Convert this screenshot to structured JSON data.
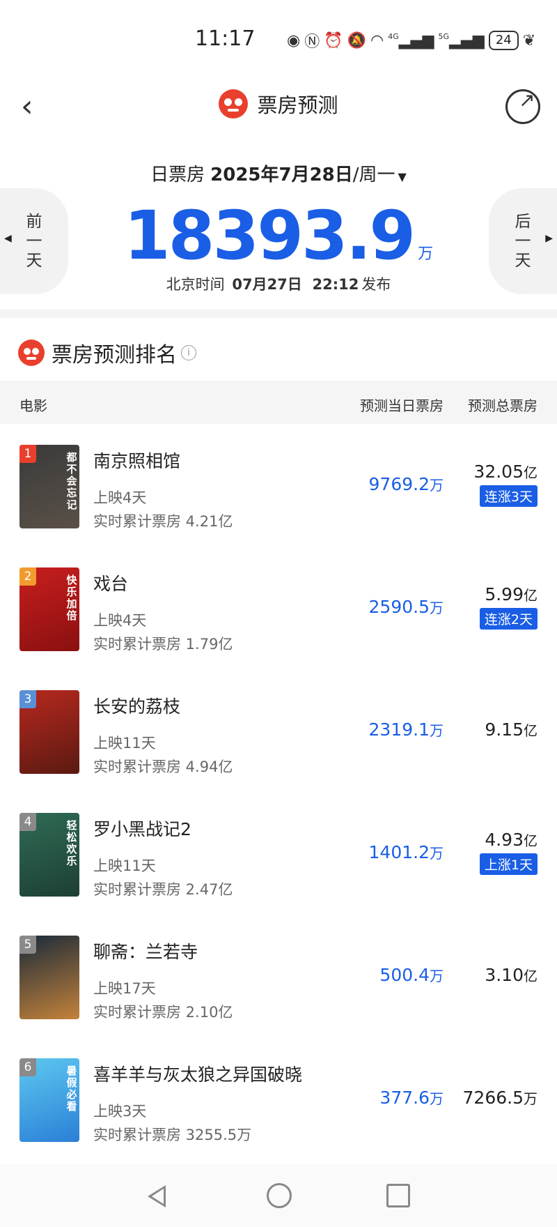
{
  "status_bar": {
    "time": "11:17",
    "battery": "24",
    "network_4g": "4G",
    "network_5g": "5G",
    "icons": [
      "eye-icon",
      "nfc-icon",
      "alarm-icon",
      "mute-icon",
      "wifi-icon",
      "signal-4g-icon",
      "signal-5g-icon",
      "battery-icon",
      "leaf-icon"
    ]
  },
  "header": {
    "title": "票房预测",
    "back_icon": "back-arrow-icon",
    "share_icon": "share-icon"
  },
  "date_selector": {
    "label": "日票房",
    "date": "2025年7月28日",
    "weekday": "/周一"
  },
  "nav_buttons": {
    "prev": [
      "前",
      "一",
      "天"
    ],
    "next": [
      "后",
      "一",
      "天"
    ]
  },
  "forecast": {
    "value": "18393.9",
    "unit": "万",
    "publish_label": "北京时间",
    "publish_date": "07月27日",
    "publish_time": "22:12",
    "publish_suffix": "发布"
  },
  "ranking": {
    "title": "票房预测排名",
    "columns": {
      "movie": "电影",
      "day_forecast": "预测当日票房",
      "total_forecast": "预测总票房"
    },
    "movies": [
      {
        "rank": "1",
        "name": "南京照相馆",
        "days": "上映4天",
        "cumulative": "实时累计票房 4.21亿",
        "day_value": "9769.2",
        "day_unit": "万",
        "total_value": "32.05",
        "total_unit": "亿",
        "trend": "连涨3天",
        "badge_color": "#e8402d",
        "poster_colors": [
          "#3a3a3a",
          "#5a5148"
        ],
        "poster_text": "都不会忘记"
      },
      {
        "rank": "2",
        "name": "戏台",
        "days": "上映4天",
        "cumulative": "实时累计票房 1.79亿",
        "day_value": "2590.5",
        "day_unit": "万",
        "total_value": "5.99",
        "total_unit": "亿",
        "trend": "连涨2天",
        "badge_color": "#f29a2e",
        "poster_colors": [
          "#c81e1e",
          "#8a1010"
        ],
        "poster_text": "快乐加倍"
      },
      {
        "rank": "3",
        "name": "长安的荔枝",
        "days": "上映11天",
        "cumulative": "实时累计票房 4.94亿",
        "day_value": "2319.1",
        "day_unit": "万",
        "total_value": "9.15",
        "total_unit": "亿",
        "trend": "",
        "badge_color": "#5b8fd6",
        "poster_colors": [
          "#b8281e",
          "#5a1a12"
        ],
        "poster_text": ""
      },
      {
        "rank": "4",
        "name": "罗小黑战记2",
        "days": "上映11天",
        "cumulative": "实时累计票房 2.47亿",
        "day_value": "1401.2",
        "day_unit": "万",
        "total_value": "4.93",
        "total_unit": "亿",
        "trend": "上涨1天",
        "badge_color": "#8a8a8a",
        "poster_colors": [
          "#2f6b55",
          "#1d3f33"
        ],
        "poster_text": "轻松欢乐"
      },
      {
        "rank": "5",
        "name": "聊斋：兰若寺",
        "days": "上映17天",
        "cumulative": "实时累计票房 2.10亿",
        "day_value": "500.4",
        "day_unit": "万",
        "total_value": "3.10",
        "total_unit": "亿",
        "trend": "",
        "badge_color": "#8a8a8a",
        "poster_colors": [
          "#1a2a3a",
          "#c4823a"
        ],
        "poster_text": ""
      },
      {
        "rank": "6",
        "name": "喜羊羊与灰太狼之异国破晓",
        "days": "上映3天",
        "cumulative": "实时累计票房 3255.5万",
        "day_value": "377.6",
        "day_unit": "万",
        "total_value": "7266.5",
        "total_unit": "万",
        "trend": "",
        "badge_color": "#8a8a8a",
        "poster_colors": [
          "#5ec8f0",
          "#2a7fd6"
        ],
        "poster_text": "暑假必看"
      }
    ]
  }
}
